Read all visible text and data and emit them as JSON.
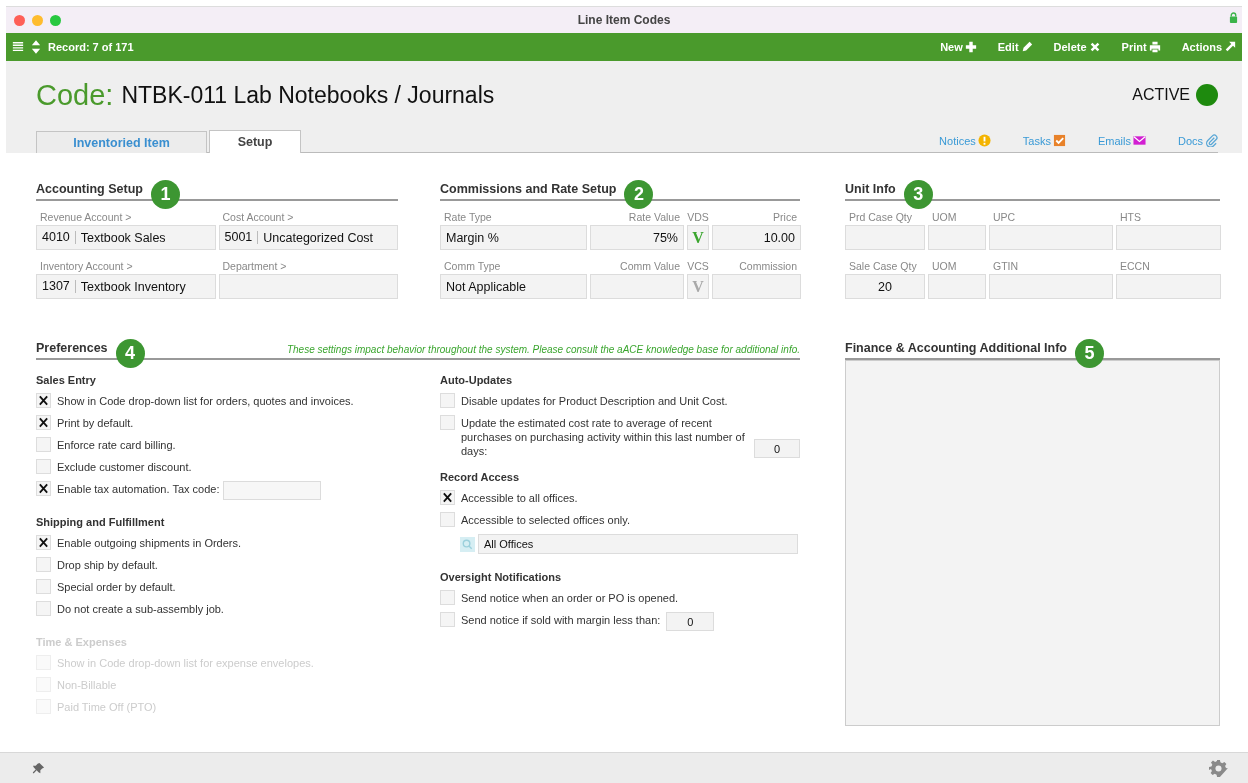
{
  "window": {
    "title": "Line Item Codes"
  },
  "toolbar": {
    "record": "Record: 7 of 171",
    "actions": [
      {
        "label": "New",
        "kind": "new"
      },
      {
        "label": "Edit",
        "kind": "edit"
      },
      {
        "label": "Delete",
        "kind": "delete"
      },
      {
        "label": "Print",
        "kind": "print"
      },
      {
        "label": "Actions",
        "kind": "actions"
      }
    ]
  },
  "header": {
    "label": "Code:",
    "value": "NTBK-011 Lab Notebooks / Journals",
    "status": {
      "label": "ACTIVE",
      "on": true
    }
  },
  "tabs": [
    {
      "label": "Inventoried Item",
      "selected": false
    },
    {
      "label": "Setup",
      "selected": true
    }
  ],
  "links": [
    {
      "label": "Notices",
      "kind": "notices"
    },
    {
      "label": "Tasks",
      "kind": "tasks"
    },
    {
      "label": "Emails",
      "kind": "emails"
    },
    {
      "label": "Docs",
      "kind": "docs"
    }
  ],
  "accounting": {
    "title": "Accounting Setup",
    "badge": "1",
    "fields": [
      {
        "label": "Revenue Account >",
        "code": "4010",
        "value": "Textbook Sales"
      },
      {
        "label": "Cost Account >",
        "code": "5001",
        "value": "Uncategorized Cost"
      },
      {
        "label": "Inventory Account >",
        "code": "1307",
        "value": "Textbook Inventory"
      },
      {
        "label": "Department >"
      }
    ]
  },
  "commissions": {
    "title": "Commissions and Rate Setup",
    "badge": "2",
    "rows": [
      {
        "type_label": "Rate Type",
        "type_value": "Margin %",
        "value_label": "Rate Value",
        "value": "75%",
        "flag_label": "VDS",
        "flag": "V",
        "flag_on": true,
        "amount_label": "Price",
        "amount": "10.00"
      },
      {
        "type_label": "Comm Type",
        "type_value": "Not Applicable",
        "value_label": "Comm Value",
        "flag_label": "VCS",
        "flag": "V",
        "flag_on": false,
        "amount_label": "Commission"
      }
    ]
  },
  "unit_info": {
    "title": "Unit Info",
    "badge": "3",
    "rows": [
      {
        "fields": [
          {
            "label": "Prd Case Qty"
          },
          {
            "label": "UOM"
          },
          {
            "label": "UPC"
          },
          {
            "label": "HTS"
          }
        ]
      },
      {
        "fields": [
          {
            "label": "Sale Case Qty",
            "value": "20"
          },
          {
            "label": "UOM"
          },
          {
            "label": "GTIN"
          },
          {
            "label": "ECCN"
          }
        ]
      }
    ]
  },
  "preferences": {
    "title": "Preferences",
    "badge": "4",
    "note": "These settings impact behavior throughout the system. Please consult the aACE knowledge base for additional info.",
    "left_groups": [
      {
        "title": "Sales Entry",
        "disabled": false,
        "items": [
          {
            "kind": "checkbox",
            "label": "Show in Code drop-down list for orders, quotes and invoices.",
            "checked": true
          },
          {
            "kind": "checkbox",
            "label": "Print by default.",
            "checked": true
          },
          {
            "kind": "checkbox",
            "label": "Enforce rate card billing.",
            "checked": false
          },
          {
            "kind": "checkbox",
            "label": "Exclude customer discount.",
            "checked": false
          },
          {
            "kind": "checkbox_field",
            "label": "Enable tax automation. Tax code:",
            "checked": true
          }
        ]
      },
      {
        "title": "Shipping and Fulfillment",
        "disabled": false,
        "items": [
          {
            "kind": "checkbox",
            "label": "Enable outgoing shipments in Orders.",
            "checked": true
          },
          {
            "kind": "checkbox",
            "label": "Drop ship by default.",
            "checked": false
          },
          {
            "kind": "checkbox",
            "label": "Special order by default.",
            "checked": false
          },
          {
            "kind": "checkbox",
            "label": "Do not create a sub-assembly job.",
            "checked": false
          }
        ]
      },
      {
        "title": "Time & Expenses",
        "disabled": true,
        "items": [
          {
            "kind": "checkbox",
            "label": "Show in Code drop-down list for expense envelopes.",
            "checked": false
          },
          {
            "kind": "checkbox",
            "label": "Non-Billable",
            "checked": false
          },
          {
            "kind": "checkbox",
            "label": "Paid Time Off (PTO)",
            "checked": false
          }
        ]
      }
    ],
    "right_groups": [
      {
        "title": "Auto-Updates",
        "disabled": false,
        "items": [
          {
            "kind": "checkbox",
            "label": "Disable updates for Product Description and Unit Cost.",
            "checked": false
          },
          {
            "kind": "checkbox_field",
            "label": "Update the estimated cost rate to average of recent purchases on purchasing activity within this last number of days:",
            "checked": false,
            "value": "0"
          }
        ]
      },
      {
        "title": "Record Access",
        "disabled": false,
        "items": [
          {
            "kind": "checkbox",
            "label": "Accessible to all offices.",
            "checked": true
          },
          {
            "kind": "checkbox",
            "label": "Accessible to selected offices only.",
            "checked": false
          },
          {
            "kind": "lookup",
            "value": "All Offices"
          }
        ]
      },
      {
        "title": "Oversight Notifications",
        "disabled": false,
        "items": [
          {
            "kind": "checkbox",
            "label": "Send notice when an order or PO is opened.",
            "checked": false
          },
          {
            "kind": "checkbox_field",
            "label": "Send notice if sold with margin less than:",
            "checked": false,
            "value": "0"
          }
        ]
      }
    ]
  },
  "finance": {
    "title": "Finance & Accounting Additional Info",
    "badge": "5"
  }
}
